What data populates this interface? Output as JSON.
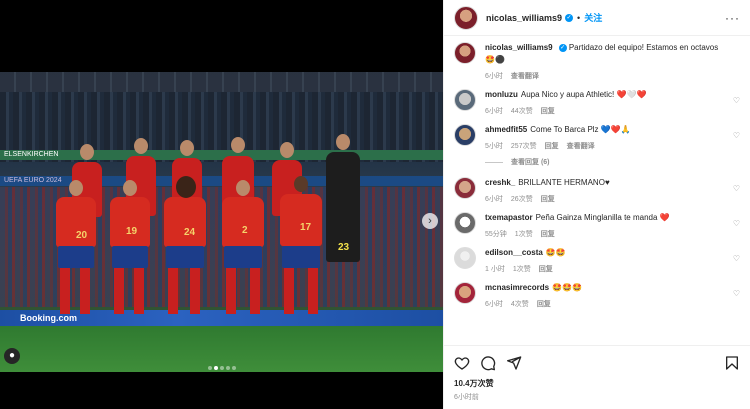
{
  "post": {
    "author": "nicolas_williams9",
    "follow_label": "关注",
    "more_label": "···",
    "caption": "Partidazo del equipo! Estamos en octavos",
    "caption_emoji": "🤩⚫",
    "caption_time": "6小时",
    "caption_translate": "查看翻译",
    "likes": "10.4万次赞",
    "time": "6小时前"
  },
  "photo": {
    "banner_top": "ELSENKIRCHEN",
    "banner_mid": "UEFA EURO 2024",
    "adboard": "Booking.com",
    "numbers": [
      "20",
      "19",
      "24",
      "2",
      "17",
      "23"
    ],
    "carousel_next": "›",
    "active_slide": 2,
    "slide_count": 5
  },
  "comments": [
    {
      "user": "monluzu",
      "text": "Aupa Nico y aupa Athletic!",
      "emoji": "❤️🤍❤️",
      "time": "6小时",
      "likes": "44次赞",
      "reply": "回复"
    },
    {
      "user": "ahmedfit55",
      "text": "Come To Barca Plz",
      "emoji": "💙❤️🙏",
      "time": "5小时",
      "likes": "257次赞",
      "reply": "回复",
      "translate": "查看翻译",
      "replies": "查看回复 (6)"
    },
    {
      "user": "creshk_",
      "text": "BRILLANTE HERMANO",
      "emoji": "♥",
      "time": "6小时",
      "likes": "26次赞",
      "reply": "回复"
    },
    {
      "user": "txemapastor",
      "text": "Peña Gainza Minglanilla te manda",
      "emoji": "❤️",
      "time": "55分钟",
      "likes": "1次赞",
      "reply": "回复"
    },
    {
      "user": "edilson__costa",
      "text": "",
      "emoji": "🤩🤩",
      "time": "1 小时",
      "likes": "1次赞",
      "reply": "回复"
    },
    {
      "user": "mcnasimrecords",
      "text": "",
      "emoji": "🤩🤩🤩",
      "time": "6小时",
      "likes": "4次赞",
      "reply": "回复"
    }
  ],
  "colors": {
    "accent": "#0095f6",
    "text": "#262626",
    "muted": "#8e8e8e"
  }
}
